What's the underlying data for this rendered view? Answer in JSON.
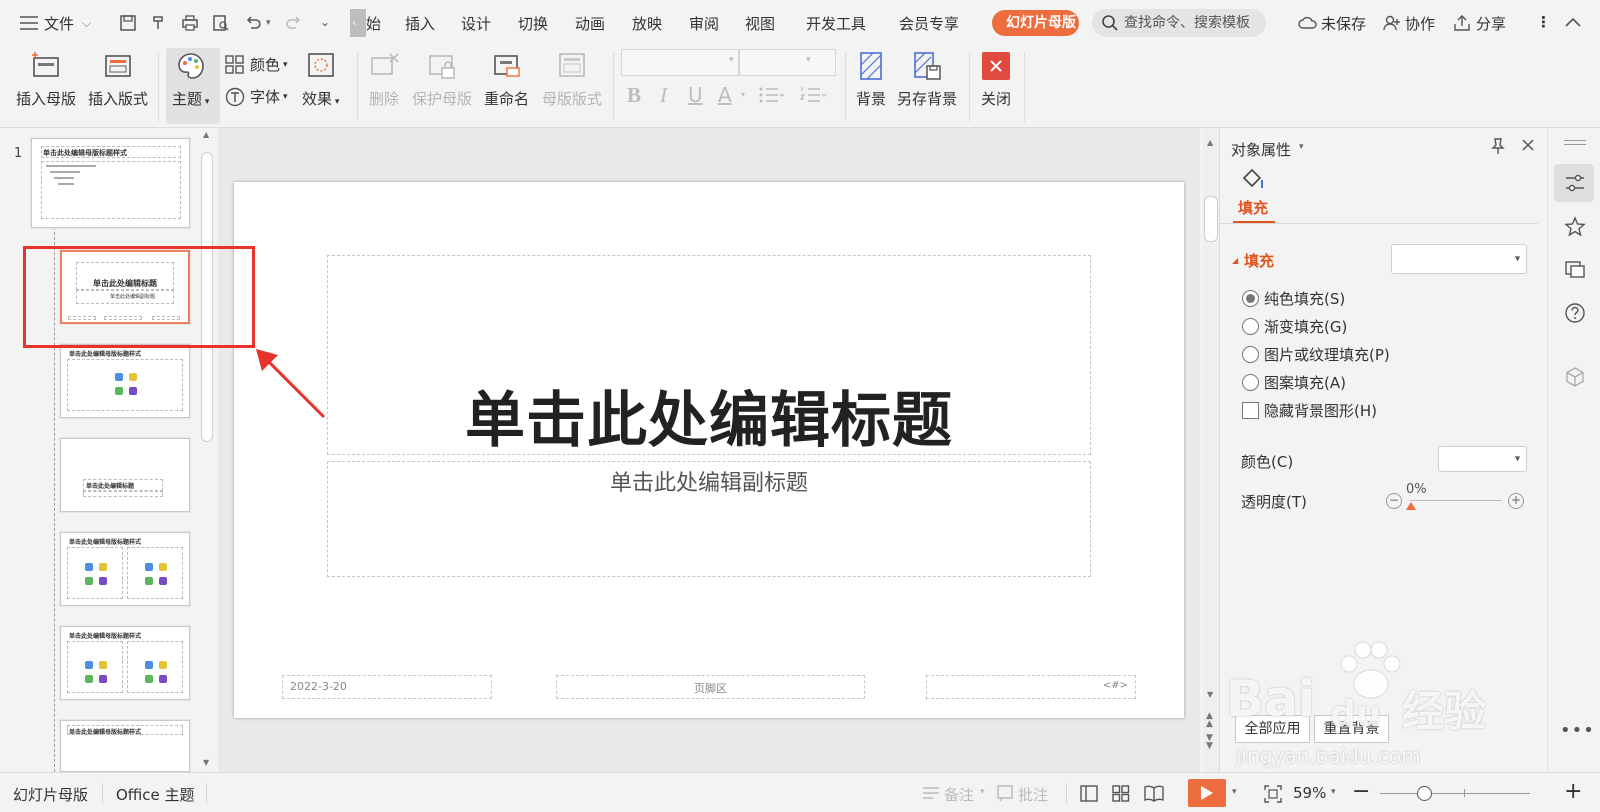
{
  "menubar": {
    "file": "文件",
    "tabs": [
      "始",
      "插入",
      "设计",
      "切换",
      "动画",
      "放映",
      "审阅",
      "视图",
      "开发工具",
      "会员专享"
    ],
    "active_tab": "幻灯片母版",
    "search_placeholder": "查找命令、搜索模板",
    "unsaved": "未保存",
    "collab": "协作",
    "share": "分享"
  },
  "ribbon": {
    "insert_master": "插入母版",
    "insert_layout": "插入版式",
    "theme": "主题",
    "color": "颜色",
    "font": "字体",
    "effect": "效果",
    "delete": "删除",
    "protect_master": "保护母版",
    "rename": "重命名",
    "master_layout": "母版版式",
    "background": "背景",
    "save_background": "另存背景",
    "close": "关闭",
    "format_b": "B",
    "format_i": "I",
    "format_u": "U",
    "format_a": "A"
  },
  "left_panel": {
    "slide_number": "1",
    "master_title": "单击此处编辑母版标题样式",
    "thumb_title": "单击此处编辑标题",
    "thumb_subtitle": "单击此处编辑副标题"
  },
  "slide": {
    "title": "单击此处编辑标题",
    "subtitle": "单击此处编辑副标题",
    "date": "2022-3-20",
    "footer": "页脚区",
    "page_num": "<#>"
  },
  "right_panel": {
    "header": "对象属性",
    "tab_fill": "填充",
    "section_fill": "填充",
    "options": [
      {
        "label": "纯色填充(S)",
        "selected": true
      },
      {
        "label": "渐变填充(G)",
        "selected": false
      },
      {
        "label": "图片或纹理填充(P)",
        "selected": false
      },
      {
        "label": "图案填充(A)",
        "selected": false
      }
    ],
    "hide_bg": "隐藏背景图形(H)",
    "color_label": "颜色(C)",
    "transparency_label": "透明度(T)",
    "transparency_value": "0%",
    "apply_all": "全部应用",
    "reset_bg": "重置背景"
  },
  "statusbar": {
    "mode": "幻灯片母版",
    "theme": "Office 主题",
    "notes": "备注",
    "comments": "批注",
    "zoom": "59%"
  },
  "watermark": {
    "brand": "Bai",
    "brand2": "du",
    "cn": "经验",
    "url": "jingyan.baidu.com"
  },
  "colors": {
    "accent": "#ee6d3e",
    "highlight": "#e8322a",
    "close_red": "#e04a3f"
  }
}
